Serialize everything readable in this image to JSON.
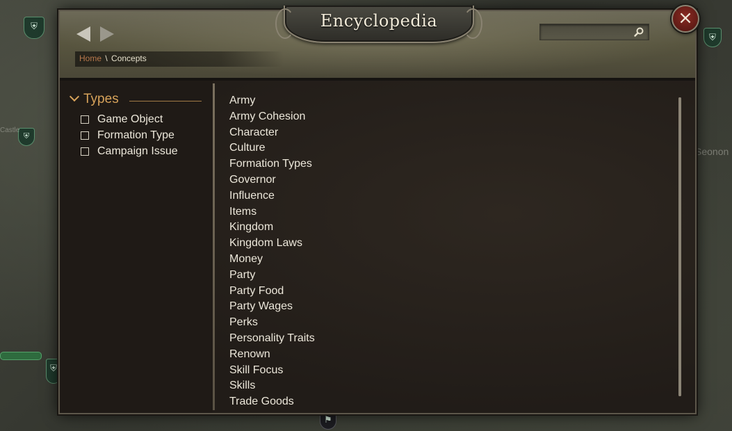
{
  "window": {
    "title": "Encyclopedia"
  },
  "breadcrumb": {
    "home": "Home",
    "separator": "\\",
    "current": "Concepts"
  },
  "search": {
    "value": "",
    "placeholder": ""
  },
  "close_label": "×",
  "map": {
    "labels": [
      "Castle",
      "Seonon"
    ]
  },
  "filters": {
    "header": "Types",
    "items": [
      {
        "label": "Game Object",
        "checked": false
      },
      {
        "label": "Formation Type",
        "checked": false
      },
      {
        "label": "Campaign Issue",
        "checked": false
      }
    ]
  },
  "concepts": [
    "Army",
    "Army Cohesion",
    "Character",
    "Culture",
    "Formation Types",
    "Governor",
    "Influence",
    "Items",
    "Kingdom",
    "Kingdom Laws",
    "Money",
    "Party",
    "Party Food",
    "Party Wages",
    "Perks",
    "Personality Traits",
    "Renown",
    "Skill Focus",
    "Skills",
    "Trade Goods"
  ],
  "colors": {
    "accent_orange": "#d6a25a",
    "home_link": "#b8784c",
    "close_red": "#8a2a22"
  }
}
